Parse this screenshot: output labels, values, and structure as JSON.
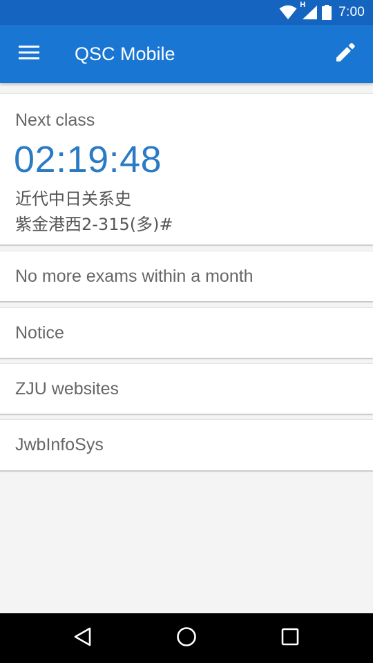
{
  "status_bar": {
    "time": "7:00",
    "network_type": "H",
    "icons": [
      "wifi-icon",
      "cellular-signal-icon",
      "battery-icon"
    ]
  },
  "app_bar": {
    "title": "QSC Mobile",
    "color": "#1976d2",
    "left_icon": "menu-icon",
    "right_icon": "edit-icon"
  },
  "next_class": {
    "label": "Next class",
    "countdown": "02:19:48",
    "course": "近代中日关系史",
    "location": "紫金港西2-315(多)#"
  },
  "cards": [
    {
      "label": "No more exams within a month"
    },
    {
      "label": "Notice"
    },
    {
      "label": "ZJU websites"
    },
    {
      "label": "JwbInfoSys"
    }
  ],
  "nav_bar": {
    "icons": [
      "back-icon",
      "home-icon",
      "recents-icon"
    ]
  }
}
